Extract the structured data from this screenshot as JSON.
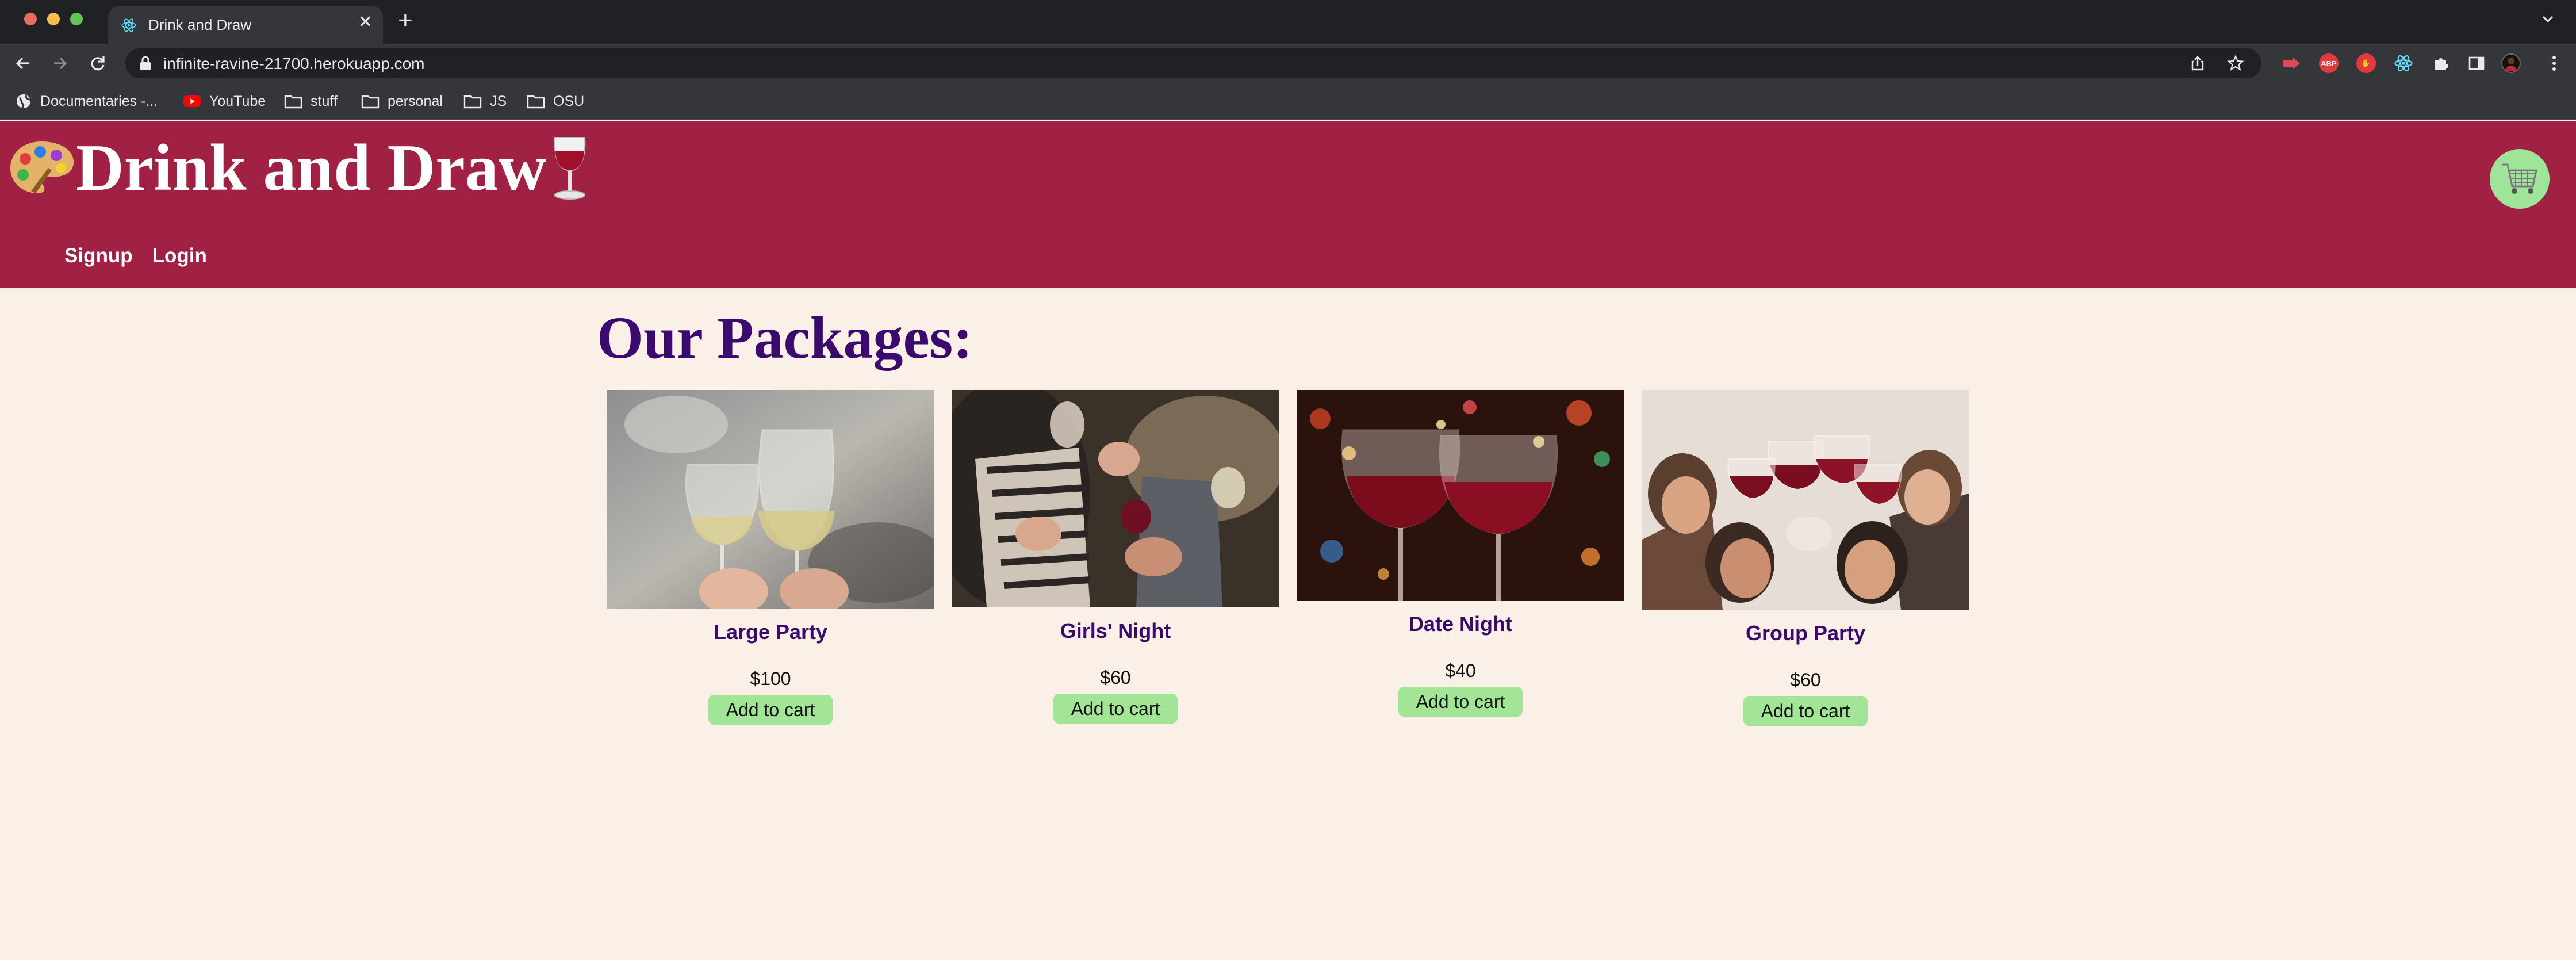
{
  "browser": {
    "tab_title": "Drink and Draw",
    "url": "infinite-ravine-21700.herokuapp.com",
    "bookmarks": [
      {
        "label": "Documentaries -...",
        "icon": "globe-icon"
      },
      {
        "label": "YouTube",
        "icon": "youtube-icon"
      },
      {
        "label": "stuff",
        "icon": "folder-icon"
      },
      {
        "label": "personal",
        "icon": "folder-icon"
      },
      {
        "label": "JS",
        "icon": "folder-icon"
      },
      {
        "label": "OSU",
        "icon": "folder-icon"
      }
    ],
    "extensions": [
      "red-arrow-extension-icon",
      "adblock-extension-icon",
      "stop-hand-extension-icon",
      "react-devtools-extension-icon",
      "puzzle-extensions-icon",
      "sidebar-toggle-icon",
      "profile-avatar"
    ]
  },
  "site": {
    "title": "Drink and Draw",
    "nav": {
      "signup": "Signup",
      "login": "Login"
    },
    "cart_icon": "shopping-cart-icon"
  },
  "packages": {
    "heading": "Our Packages:",
    "add_label": "Add to cart",
    "items": [
      {
        "name": "Large Party",
        "price": "$100",
        "image": "white-wine-glasses-toast-photo"
      },
      {
        "name": "Girls' Night",
        "price": "$60",
        "image": "friends-with-wine-photo"
      },
      {
        "name": "Date Night",
        "price": "$40",
        "image": "two-red-wine-glasses-bokeh-photo"
      },
      {
        "name": "Group Party",
        "price": "$60",
        "image": "group-red-wine-toast-photo"
      }
    ]
  },
  "colors": {
    "header_bg": "#a02143",
    "page_bg": "#faf0e8",
    "accent_purple": "#3a0a6e",
    "button_green": "#a3e596",
    "cart_green": "#9ee59a"
  }
}
